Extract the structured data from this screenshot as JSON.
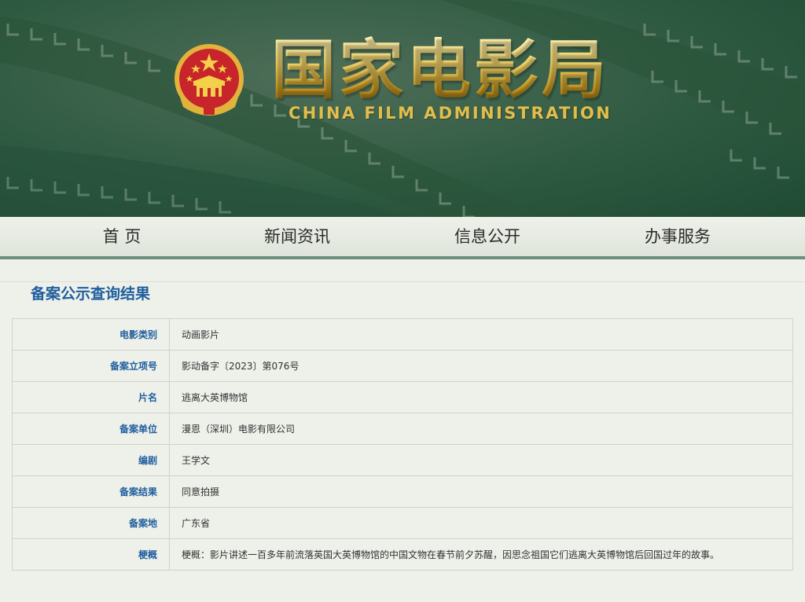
{
  "header": {
    "title_cn": "国家电影局",
    "title_en": "CHINA FILM ADMINISTRATION",
    "emblem_icon": "national-emblem-icon"
  },
  "nav": {
    "items": [
      {
        "label": "首 页"
      },
      {
        "label": "新闻资讯"
      },
      {
        "label": "信息公开"
      },
      {
        "label": "办事服务"
      }
    ]
  },
  "main": {
    "section_title": "备案公示查询结果",
    "rows": [
      {
        "label": "电影类别",
        "value": "动画影片"
      },
      {
        "label": "备案立项号",
        "value": "影动备字〔2023〕第076号"
      },
      {
        "label": "片名",
        "value": "逃离大英博物馆"
      },
      {
        "label": "备案单位",
        "value": "漫恩（深圳）电影有限公司"
      },
      {
        "label": "编剧",
        "value": "王学文"
      },
      {
        "label": "备案结果",
        "value": "同意拍摄"
      },
      {
        "label": "备案地",
        "value": "广东省"
      },
      {
        "label": "梗概",
        "value": "梗概：影片讲述一百多年前流落英国大英博物馆的中国文物在春节前夕苏醒，因思念祖国它们逃离大英博物馆后回国过年的故事。"
      }
    ]
  },
  "colors": {
    "banner_green": "#2f5a42",
    "gold": "#e9c85a",
    "label_blue": "#1f5f9e",
    "nav_border": "#6e8f7c",
    "page_bg": "#eef0ea"
  }
}
